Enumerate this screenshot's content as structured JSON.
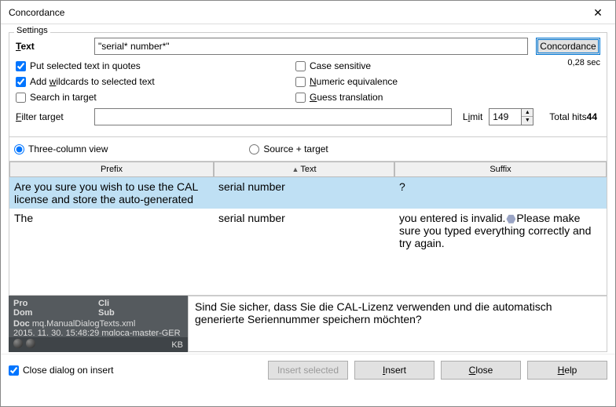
{
  "window": {
    "title": "Concordance"
  },
  "settings": {
    "label": "Settings",
    "text_label": "Text",
    "query": "\"serial* number*\"",
    "concordance_btn": "Concordance",
    "elapsed": "0,28 sec",
    "opt_quotes": "Put selected text in quotes",
    "opt_wildcards": "Add wildcards to selected text",
    "opt_search_target": "Search in target",
    "opt_case": "Case sensitive",
    "opt_numeric": "Numeric equivalence",
    "opt_guess": "Guess translation",
    "filter_label": "Filter target",
    "filter_value": "",
    "limit_label": "Limit",
    "limit_value": "149",
    "total_hits_label": "Total hits",
    "total_hits_value": "44"
  },
  "view": {
    "three_col": "Three-column view",
    "source_target": "Source + target"
  },
  "table": {
    "headers": {
      "prefix": "Prefix",
      "text": "Text",
      "suffix": "Suffix"
    },
    "rows": [
      {
        "prefix": "Are you sure you wish to use the CAL license and store the auto-generated",
        "text": "serial number",
        "suffix": "?"
      },
      {
        "prefix": "The",
        "text": "serial number",
        "suffix_a": " you entered is invalid.",
        "suffix_b": "Please make sure you typed everything correctly and try again."
      }
    ]
  },
  "meta": {
    "pro": "Pro",
    "cli": "Cli",
    "dom": "Dom",
    "sub": "Sub",
    "doc_label": "Doc",
    "doc_name": "mq.ManualDialogTexts.xml",
    "timestamp": "2015. 11. 30. 15:48:29 mqloca-master-GER",
    "kb": "KB",
    "translation": "Sind Sie sicher, dass Sie die CAL-Lizenz verwenden und die automatisch generierte Seriennummer speichern möchten?"
  },
  "footer": {
    "close_on_insert": "Close dialog on insert",
    "insert_selected": "Insert selected",
    "insert": "Insert",
    "close": "Close",
    "help": "Help"
  }
}
